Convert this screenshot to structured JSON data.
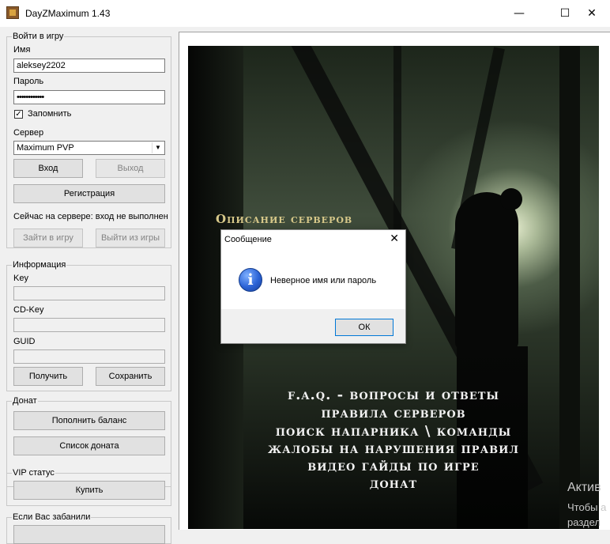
{
  "window": {
    "title": "DayZMaximum 1.43",
    "minimize": "—",
    "maximize": "☐",
    "close": "✕"
  },
  "login": {
    "legend": "Войти в игру",
    "name_label": "Имя",
    "name_value": "aleksey2202",
    "password_label": "Пароль",
    "password_value": "••••••••••••",
    "remember_label": "Запомнить",
    "remember_checked": "✓",
    "server_label": "Сервер",
    "server_value": "Maximum PVP",
    "enter_button": "Вход",
    "exit_button": "Выход",
    "register_button": "Регистрация",
    "status_text": "Сейчас на сервере:  вход не выполнен",
    "join_button": "Зайти в игру",
    "leave_button": "Выйти из игры"
  },
  "info": {
    "legend": "Информация",
    "key_label": "Key",
    "cdkey_label": "CD-Key",
    "guid_label": "GUID",
    "get_button": "Получить",
    "save_button": "Сохранить"
  },
  "donate": {
    "legend": "Донат",
    "topup_button": "Пополнить баланс",
    "list_button": "Список доната"
  },
  "vip": {
    "legend": "VIP статус",
    "buy_button": "Купить"
  },
  "banned": {
    "legend": "Если Вас забанили"
  },
  "banner": {
    "section_title": "Описание серверов",
    "menu": [
      "F.A.Q. - Вопросы и ответы",
      "Правила серверов",
      "Поиск напарника \\ команды",
      "Жалобы на нарушения правил",
      "Видео гайды по игре",
      "Донат"
    ]
  },
  "dialog": {
    "title": "Сообщение",
    "close": "✕",
    "icon": "info-icon",
    "message": "Неверное имя или пароль",
    "ok_button": "ОК"
  },
  "watermark": {
    "line1": "Актив",
    "line2": "Чтобы а",
    "line3": "раздел"
  }
}
